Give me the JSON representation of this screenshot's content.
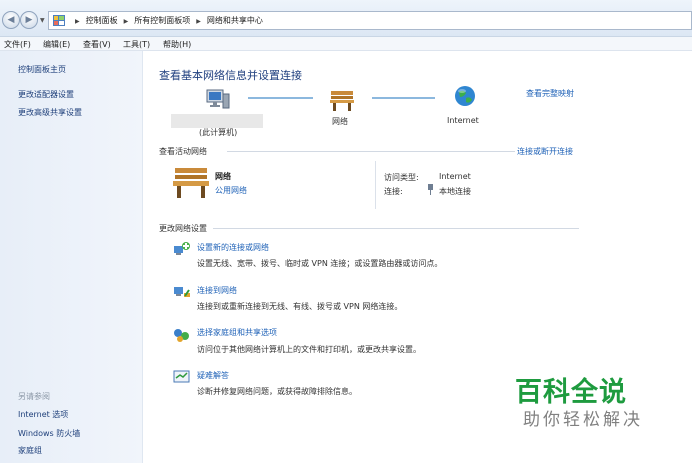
{
  "breadcrumb": [
    "控制面板",
    "所有控制面板项",
    "网络和共享中心"
  ],
  "menu": [
    "文件(F)",
    "编辑(E)",
    "查看(V)",
    "工具(T)",
    "帮助(H)"
  ],
  "sidebar": {
    "home": "控制面板主页",
    "links": [
      "更改适配器设置",
      "更改高级共享设置"
    ],
    "see_also_heading": "另请参阅",
    "see_also": [
      "Internet 选项",
      "Windows 防火墙",
      "家庭组"
    ]
  },
  "main": {
    "title": "查看基本网络信息并设置连接",
    "full_map": "查看完整映射",
    "map": {
      "computer": "(此计算机)",
      "network": "网络",
      "internet": "Internet"
    },
    "active_heading": "查看活动网络",
    "connect_disconnect": "连接或断开连接",
    "active": {
      "name": "网络",
      "type": "公用网络",
      "access_label": "访问类型:",
      "access_value": "Internet",
      "conn_label": "连接:",
      "conn_value": "本地连接"
    },
    "change_heading": "更改网络设置",
    "tasks": [
      {
        "title": "设置新的连接或网络",
        "desc": "设置无线、宽带、拨号、临时或 VPN 连接；或设置路由器或访问点。",
        "icon": "new-connection-icon"
      },
      {
        "title": "连接到网络",
        "desc": "连接到或重新连接到无线、有线、拨号或 VPN 网络连接。",
        "icon": "connect-network-icon"
      },
      {
        "title": "选择家庭组和共享选项",
        "desc": "访问位于其他网络计算机上的文件和打印机，或更改共享设置。",
        "icon": "homegroup-icon"
      },
      {
        "title": "疑难解答",
        "desc": "诊断并修复网络问题，或获得故障排除信息。",
        "icon": "troubleshoot-icon"
      }
    ]
  },
  "watermark": {
    "brand": "百科全说",
    "sub": "助你轻松解决"
  },
  "colors": {
    "link": "#1f62b7",
    "heading": "#1e3e7e",
    "watermark": "#1e9b3f"
  }
}
